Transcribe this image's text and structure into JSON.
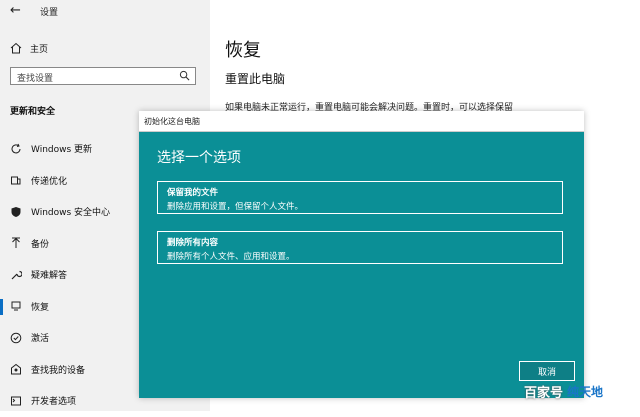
{
  "window": {
    "title": "设置"
  },
  "sidebar": {
    "home_label": "主页",
    "search_placeholder": "查找设置",
    "section_title": "更新和安全",
    "items": [
      {
        "label": "Windows 更新",
        "icon": "sync-icon"
      },
      {
        "label": "传递优化",
        "icon": "delivery-icon"
      },
      {
        "label": "Windows 安全中心",
        "icon": "shield-icon"
      },
      {
        "label": "备份",
        "icon": "backup-icon"
      },
      {
        "label": "疑难解答",
        "icon": "wrench-icon"
      },
      {
        "label": "恢复",
        "icon": "recovery-icon",
        "active": true
      },
      {
        "label": "激活",
        "icon": "check-circle-icon"
      },
      {
        "label": "查找我的设备",
        "icon": "find-device-icon"
      },
      {
        "label": "开发者选项",
        "icon": "developer-icon"
      }
    ]
  },
  "main": {
    "title": "恢复",
    "subtitle": "重置此电脑",
    "description": "如果电脑未正常运行，重置电脑可能会解决问题。重置时，可以选择保留"
  },
  "dialog": {
    "titlebar": "初始化这台电脑",
    "heading": "选择一个选项",
    "options": [
      {
        "title": "保留我的文件",
        "desc": "删除应用和设置，但保留个人文件。"
      },
      {
        "title": "删除所有内容",
        "desc": "删除所有个人文件、应用和设置。"
      }
    ],
    "cancel_label": "取消"
  },
  "watermark": {
    "left": "百家号",
    "right": "纯天地"
  },
  "colors": {
    "dialog_bg": "#0b8f96",
    "accent": "#0a6ec4"
  }
}
